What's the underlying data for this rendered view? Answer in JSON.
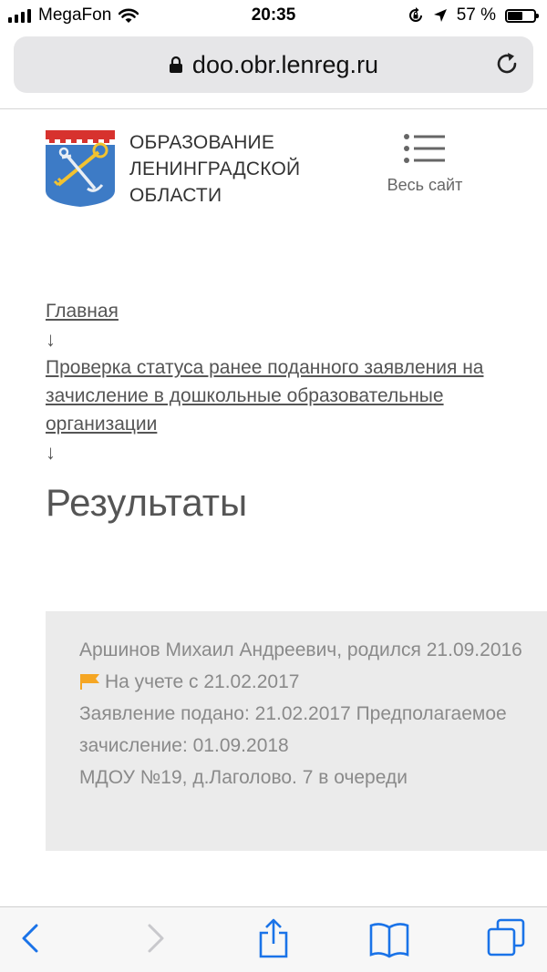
{
  "status_bar": {
    "carrier": "MegaFon",
    "time": "20:35",
    "battery_percent": "57 %",
    "battery_level": 0.57
  },
  "browser": {
    "url": "doo.obr.lenreg.ru",
    "lock_icon": "lock-icon",
    "reload_icon": "reload-icon"
  },
  "header": {
    "org_line1": "ОБРАЗОВАНИЕ",
    "org_line2": "ЛЕНИНГРАДСКОЙ",
    "org_line3": "ОБЛАСТИ",
    "menu_label": "Весь сайт"
  },
  "breadcrumb": {
    "home": "Главная",
    "arrow": "↓",
    "section": "Проверка статуса ранее поданного заявления на зачисление в дошкольные образовательные организации"
  },
  "page_title": "Результаты",
  "result": {
    "line1": "Аршинов Михаил Андреевич, родился 21.09.2016",
    "status": "На учете с 21.02.2017",
    "line3": "Заявление подано: 21.02.2017 Предполагаемое зачисление: 01.09.2018",
    "line4": "МДОУ №19, д.Лаголово. 7 в очереди",
    "flag_color": "#f5a623"
  },
  "toolbar": {
    "back_icon": "back-icon",
    "forward_icon": "forward-icon",
    "share_icon": "share-icon",
    "bookmarks_icon": "bookmarks-icon",
    "tabs_icon": "tabs-icon",
    "accent_color": "#1a73e8"
  }
}
